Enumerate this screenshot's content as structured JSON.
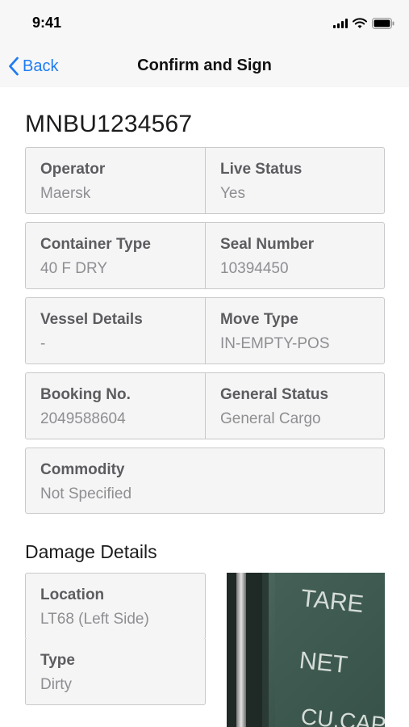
{
  "status_bar": {
    "time": "9:41"
  },
  "nav": {
    "back_label": "Back",
    "title": "Confirm and Sign"
  },
  "container_id": "MNBU1234567",
  "details": [
    [
      {
        "label": "Operator",
        "value": "Maersk"
      },
      {
        "label": "Live Status",
        "value": "Yes"
      }
    ],
    [
      {
        "label": "Container Type",
        "value": "40 F DRY"
      },
      {
        "label": "Seal Number",
        "value": "10394450"
      }
    ],
    [
      {
        "label": "Vessel Details",
        "value": "-"
      },
      {
        "label": "Move Type",
        "value": "IN-EMPTY-POS"
      }
    ],
    [
      {
        "label": "Booking No.",
        "value": "2049588604"
      },
      {
        "label": "General Status",
        "value": "General Cargo"
      }
    ],
    [
      {
        "label": "Commodity",
        "value": "Not Specified"
      }
    ]
  ],
  "damage": {
    "title": "Damage Details",
    "location": {
      "label": "Location",
      "value": "LT68 (Left Side)"
    },
    "type": {
      "label": "Type",
      "value": "Dirty"
    },
    "photo_text": [
      "TARE",
      "NET",
      "CU.CAP"
    ]
  },
  "colors": {
    "accent": "#1e7cf2",
    "card_bg": "#f5f5f5",
    "border": "#c9c9cc"
  }
}
